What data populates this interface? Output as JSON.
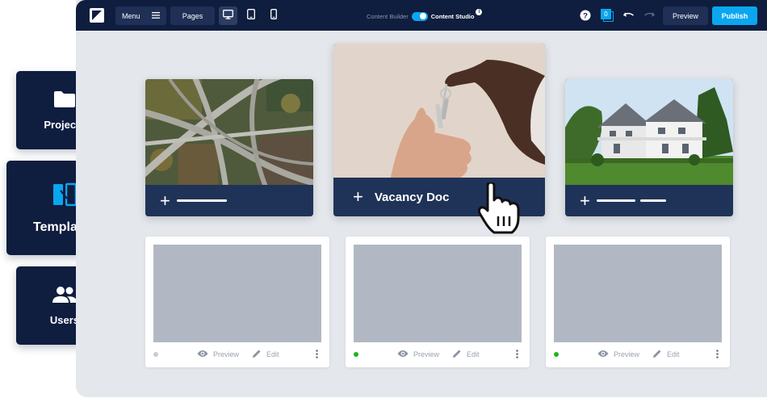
{
  "topbar": {
    "menu_label": "Menu",
    "pages_label": "Pages",
    "toggle_left_label": "Content Builder",
    "toggle_right_label": "Content Studio",
    "info_label": "i",
    "notification_count": "0",
    "preview_label": "Preview",
    "publish_label": "Publish",
    "colors": {
      "bar": "#0f1d3f",
      "accent": "#0aa6f0"
    }
  },
  "nav": {
    "projects_label": "Projects",
    "templates_label": "Templates",
    "users_label": "Users"
  },
  "featured": {
    "vacancy_title": "Vacancy Doc"
  },
  "pages": [
    {
      "status_color": "#c9ccd3",
      "preview_label": "Preview",
      "edit_label": "Edit"
    },
    {
      "status_color": "#1fb31f",
      "preview_label": "Preview",
      "edit_label": "Edit"
    },
    {
      "status_color": "#1fb31f",
      "preview_label": "Preview",
      "edit_label": "Edit"
    }
  ]
}
